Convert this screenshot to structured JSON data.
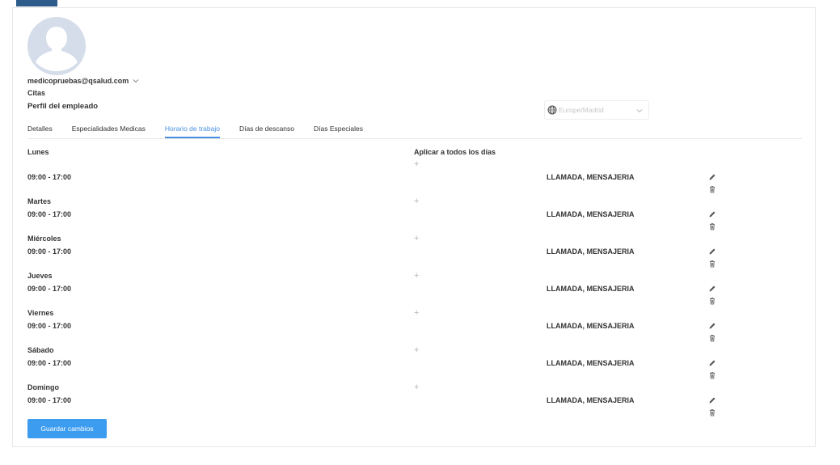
{
  "profile": {
    "email": "medicopruebas@qsalud.com",
    "subtitle": "Citas",
    "title": "Perfil del empleado"
  },
  "timezone": {
    "placeholder": "Europe/Madrid"
  },
  "tabs": [
    {
      "label": "Detalles",
      "active": false
    },
    {
      "label": "Especialidades Medicas",
      "active": false
    },
    {
      "label": "Horario de trabajo",
      "active": true
    },
    {
      "label": "Días de descanso",
      "active": false
    },
    {
      "label": "Días Especiales",
      "active": false
    }
  ],
  "schedule": {
    "apply_all_label": "Aplicar a todos los días",
    "plus_symbol": "+",
    "days": [
      {
        "name": "Lunes",
        "time": "09:00 - 17:00",
        "services": "LLAMADA, MENSAJERIA"
      },
      {
        "name": "Martes",
        "time": "09:00 - 17:00",
        "services": "LLAMADA, MENSAJERIA"
      },
      {
        "name": "Miércoles",
        "time": "09:00 - 17:00",
        "services": "LLAMADA, MENSAJERIA"
      },
      {
        "name": "Jueves",
        "time": "09:00 - 17:00",
        "services": "LLAMADA, MENSAJERIA"
      },
      {
        "name": "Viernes",
        "time": "09:00 - 17:00",
        "services": "LLAMADA, MENSAJERIA"
      },
      {
        "name": "Sábado",
        "time": "09:00 - 17:00",
        "services": "LLAMADA, MENSAJERIA"
      },
      {
        "name": "Domingo",
        "time": "09:00 - 17:00",
        "services": "LLAMADA, MENSAJERIA"
      }
    ]
  },
  "save_button": "Guardar cambios",
  "colors": {
    "accent": "#4a90e2",
    "button": "#3c9cf0",
    "avatar_bg": "#d4dde9",
    "top_accent": "#2d5c8a"
  },
  "icons": [
    "user-silhouette-icon",
    "chevron-down-icon",
    "globe-icon",
    "plus-icon",
    "edit-pencil-icon",
    "trash-icon"
  ]
}
